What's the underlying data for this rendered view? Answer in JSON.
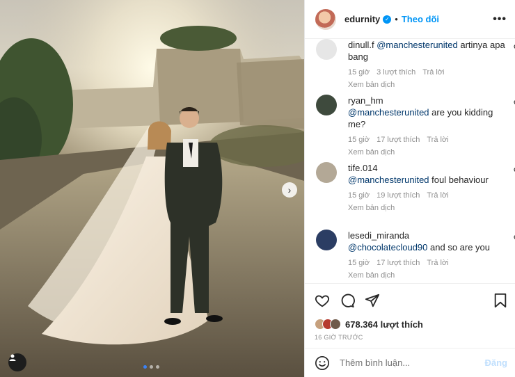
{
  "header": {
    "username": "edurnity",
    "separator": "•",
    "follow_label": "Theo dõi",
    "more_icon": "more-icon"
  },
  "comments": [
    {
      "user": "dinull.f",
      "mention": "@manchesterunited",
      "text": "artinya apa bang",
      "time": "15 giờ",
      "likes": "3 lượt thích",
      "reply": "Trả lời",
      "translate": "Xem bản dịch",
      "avatar_color": "#e6e6e6"
    },
    {
      "user": "ryan_hm",
      "mention": "@manchesterunited",
      "text": "are you kidding me?",
      "time": "15 giờ",
      "likes": "17 lượt thích",
      "reply": "Trả lời",
      "translate": "Xem bản dịch",
      "avatar_color": "#3e4a3d"
    },
    {
      "user": "tife.014",
      "mention": "@manchesterunited",
      "text": "foul behaviour",
      "time": "15 giờ",
      "likes": "19 lượt thích",
      "reply": "Trả lời",
      "translate": "Xem bản dịch",
      "avatar_color": "#b3a896"
    },
    {
      "user": "lesedi_miranda",
      "mention": "@chocolatecloud90",
      "text": "and so are you",
      "time": "15 giờ",
      "likes": "17 lượt thích",
      "reply": "Trả lời",
      "translate": "Xem bản dịch",
      "avatar_color": "#2b3d63"
    }
  ],
  "actions": {
    "likes_text": "678.364 lượt thích",
    "time_ago": "16 GIỜ TRƯỚC"
  },
  "add_comment": {
    "placeholder": "Thêm bình luận...",
    "post_label": "Đăng"
  },
  "carousel": {
    "slide_count": 3,
    "active_slide": 1
  }
}
